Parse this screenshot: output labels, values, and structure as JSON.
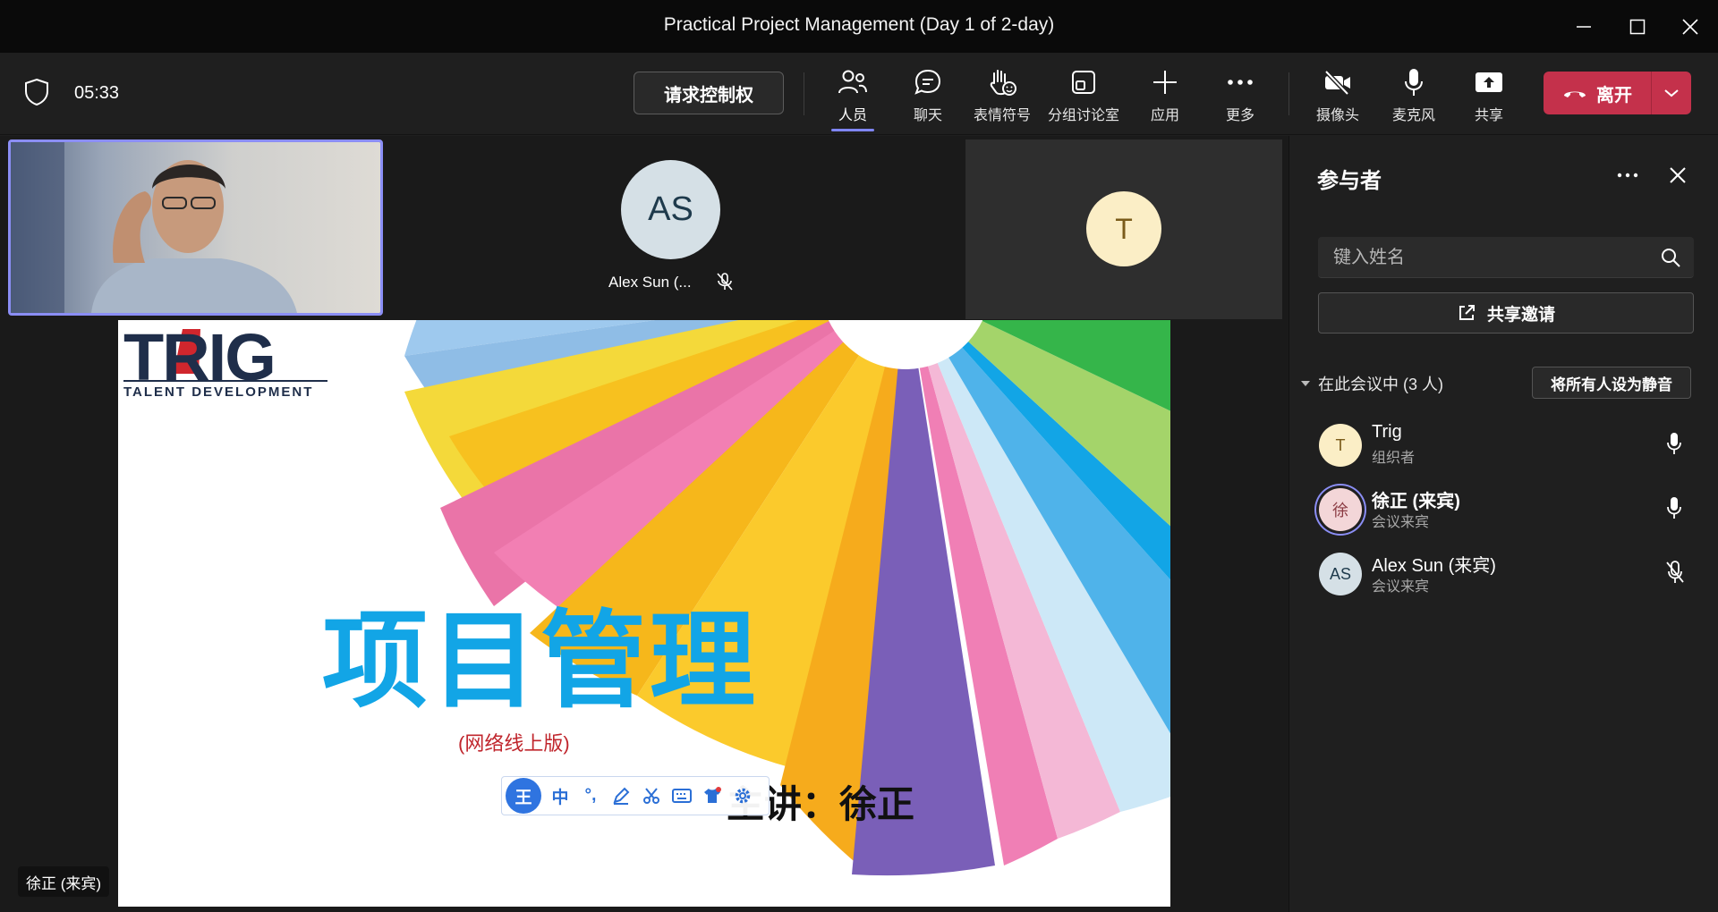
{
  "window": {
    "title": "Practical Project Management (Day 1 of 2-day)"
  },
  "toolbar": {
    "timer": "05:33",
    "request_control": "请求控制权",
    "items": [
      {
        "label": "人员",
        "icon": "people-icon"
      },
      {
        "label": "聊天",
        "icon": "chat-icon"
      },
      {
        "label": "表情符号",
        "icon": "raise-hand-icon"
      },
      {
        "label": "分组讨论室",
        "icon": "breakout-rooms-icon"
      },
      {
        "label": "应用",
        "icon": "add-apps-icon"
      },
      {
        "label": "更多",
        "icon": "more-icon"
      },
      {
        "label": "摄像头",
        "icon": "camera-off-icon"
      },
      {
        "label": "麦克风",
        "icon": "microphone-icon"
      },
      {
        "label": "共享",
        "icon": "share-screen-icon"
      }
    ],
    "leave": "离开"
  },
  "stage": {
    "tiles": [
      {
        "initials": "AS",
        "name": "Alex Sun (..."
      },
      {
        "initials": "T"
      }
    ],
    "self_name": "徐正 (来宾)"
  },
  "slide": {
    "logo": "TRIG",
    "logo_sub": "TALENT DEVELOPMENT",
    "title": "项目管理",
    "subtitle": "(网络线上版)",
    "presenter": "主讲：徐正",
    "ime": {
      "logo": "王",
      "mode": "中",
      "punct": "°,"
    }
  },
  "panel": {
    "title": "参与者",
    "search_placeholder": "键入姓名",
    "share_invite": "共享邀请",
    "section": "在此会议中 (3 人)",
    "mute_all": "将所有人设为静音",
    "participants": [
      {
        "initials": "T",
        "name": "Trig",
        "role": "组织者",
        "mic": "microphone-icon",
        "avatar_bg": "#fbeec6",
        "avatar_fg": "#7a5b1a"
      },
      {
        "initials": "徐",
        "name": "徐正 (来宾)",
        "role": "会议来宾",
        "mic": "microphone-icon",
        "avatar_bg": "#f3d6d8",
        "avatar_fg": "#8a3a42"
      },
      {
        "initials": "AS",
        "name": "Alex Sun (来宾)",
        "role": "会议来宾",
        "mic": "microphone-muted-icon",
        "avatar_bg": "#d5e0e6",
        "avatar_fg": "#1e3a4c"
      }
    ]
  },
  "colors": {
    "accent": "#7f85f5",
    "leave": "#c4314b",
    "slide_title": "#12a5e6",
    "slide_subtitle": "#c0262d"
  }
}
